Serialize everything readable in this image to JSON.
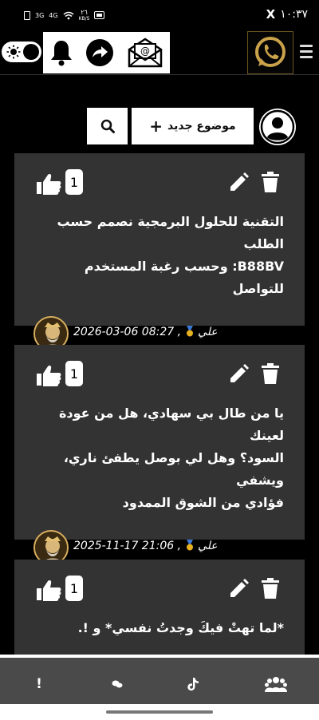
{
  "status_bar": {
    "net_3g": "3G",
    "net_4g": "4G",
    "speed_value": "٢٦",
    "speed_unit": "KB/S",
    "x_app_label": "X",
    "time": "١٠:٣٧"
  },
  "header": {
    "theme_toggle_icon": "sun-icon",
    "icons": [
      "bell-icon",
      "share-icon",
      "envelope-icon"
    ],
    "logo_icon": "whatsapp-icon",
    "menu_icon": "hamburger-icon"
  },
  "actions": {
    "new_topic_label": "موضوع جديد",
    "new_topic_icon": "+",
    "search_icon": "search-icon",
    "profile_icon": "user-icon"
  },
  "posts": [
    {
      "likes": "1",
      "lines": [
        "التقنية للحلول البرمجية نصمم حسب الطلب",
        "B88BV: وحسب رغبة المستخدم للتواصل"
      ],
      "author": "علي",
      "date": "2026-03-06 08:27"
    },
    {
      "likes": "1",
      "lines": [
        "يا من طال بي سهادي، هل من عودة لعينك",
        "السود؟ وهل لي بوصل يطفئ ناري، ويشفي",
        "فؤادي من الشوق الممدود"
      ],
      "author": "علي",
      "date": "2025-11-17 21:06"
    },
    {
      "likes": "1",
      "lines": [
        "*لما تهتْ فيكَ وجدتُ نفسي* و !."
      ],
      "author": "",
      "date": ""
    }
  ],
  "bottom_nav": {
    "items": [
      {
        "icon": "info-icon",
        "glyph": "!"
      },
      {
        "icon": "chat-icon",
        "glyph": ""
      },
      {
        "icon": "tiktok-icon",
        "glyph": ""
      },
      {
        "icon": "group-icon",
        "glyph": ""
      }
    ]
  },
  "colors": {
    "background": "#000000",
    "card": "#333333",
    "nav": "#4a4a4a",
    "accent_gold": "#c9a24a"
  }
}
